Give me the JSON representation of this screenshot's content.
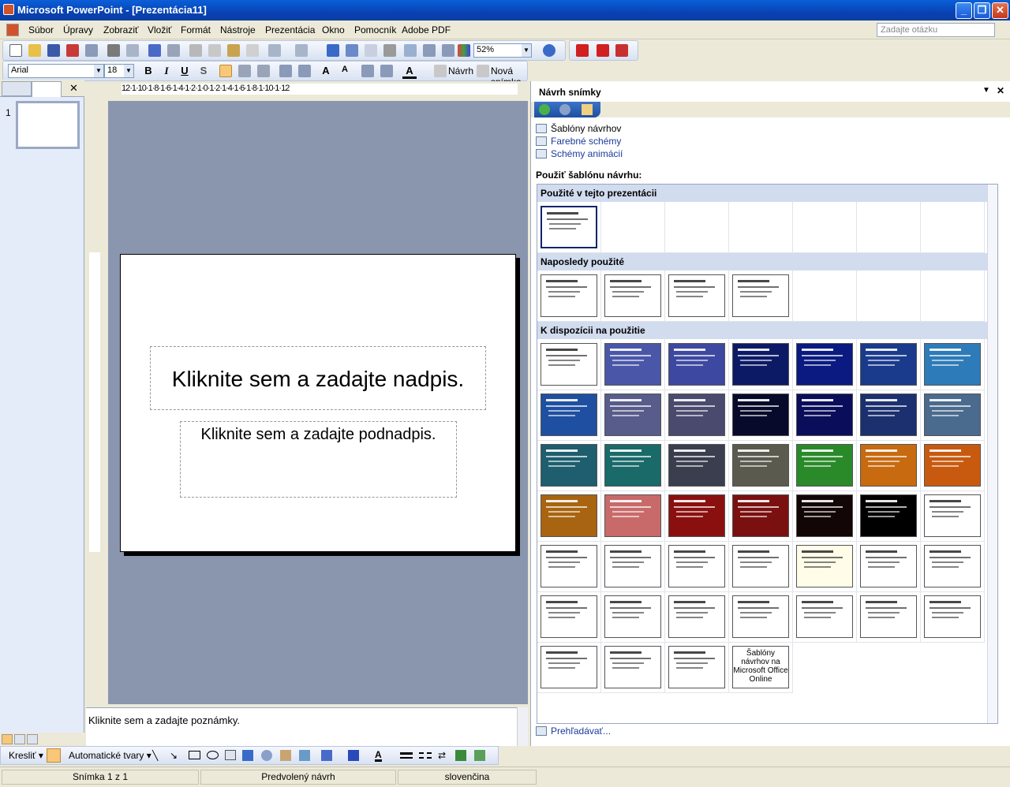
{
  "window": {
    "title": "Microsoft PowerPoint - [Prezentácia11]"
  },
  "menu": {
    "items": [
      "Súbor",
      "Úpravy",
      "Zobraziť",
      "Vložiť",
      "Formát",
      "Nástroje",
      "Prezentácia",
      "Okno",
      "Pomocník",
      "Adobe PDF"
    ],
    "help_placeholder": "Zadajte otázku"
  },
  "toolbar": {
    "zoom": "52%",
    "font": "Arial",
    "size": "18",
    "design_label": "Návrh",
    "new_slide_label": "Nová snímka"
  },
  "outline": {
    "slide_number": "1"
  },
  "ruler": {
    "h_scale": "12·1·10·1·8·1·6·1·4·1·2·1·0·1·2·1·4·1·6·1·8·1·10·1·12"
  },
  "slide": {
    "title_placeholder": "Kliknite sem a zadajte nadpis.",
    "subtitle_placeholder": "Kliknite sem a zadajte podnadpis."
  },
  "notes": {
    "placeholder": "Kliknite sem a zadajte poznámky."
  },
  "taskpane": {
    "title": "Návrh snímky",
    "links": [
      "Šablóny návrhov",
      "Farebné schémy",
      "Schémy animácií"
    ],
    "apply_label": "Použiť šablónu návrhu:",
    "sections": {
      "used": "Použité v tejto prezentácii",
      "recent": "Naposledy použité",
      "available": "K dispozícii na použitie"
    },
    "online_label": "Šablóny návrhov na Microsoft Office Online",
    "browse": "Prehľadávať..."
  },
  "drawing": {
    "draw_label": "Kresliť",
    "autoshapes_label": "Automatické tvary"
  },
  "status": {
    "slide": "Snímka 1 z 1",
    "design": "Predvolený návrh",
    "language": "slovenčina"
  },
  "colors": {
    "available": [
      "#ffffff",
      "#4a56a8",
      "#3d48a0",
      "#0c1a66",
      "#0a1a80",
      "#1a3a8c",
      "#2d7bb8",
      "#1f4fa0",
      "#585c8a",
      "#4a4a6e",
      "#070a2a",
      "#0a0e5a",
      "#1c2f6e",
      "#4a6a8e",
      "#1e5e6e",
      "#1a6a6a",
      "#3a3e4e",
      "#5a5a4e",
      "#2a8a2a",
      "#c86a10",
      "#c85a10",
      "#a86410",
      "#c86a6a",
      "#8a1010",
      "#7a1010",
      "#120606",
      "#000000",
      "#ffffff",
      "#ffffff",
      "#ffffff",
      "#ffffff",
      "#ffffff",
      "#fffde8",
      "#ffffff",
      "#ffffff",
      "#ffffff",
      "#ffffff",
      "#ffffff",
      "#ffffff",
      "#ffffff",
      "#ffffff",
      "#ffffff",
      "#ffffff",
      "#ffffff",
      "#ffffff"
    ]
  }
}
